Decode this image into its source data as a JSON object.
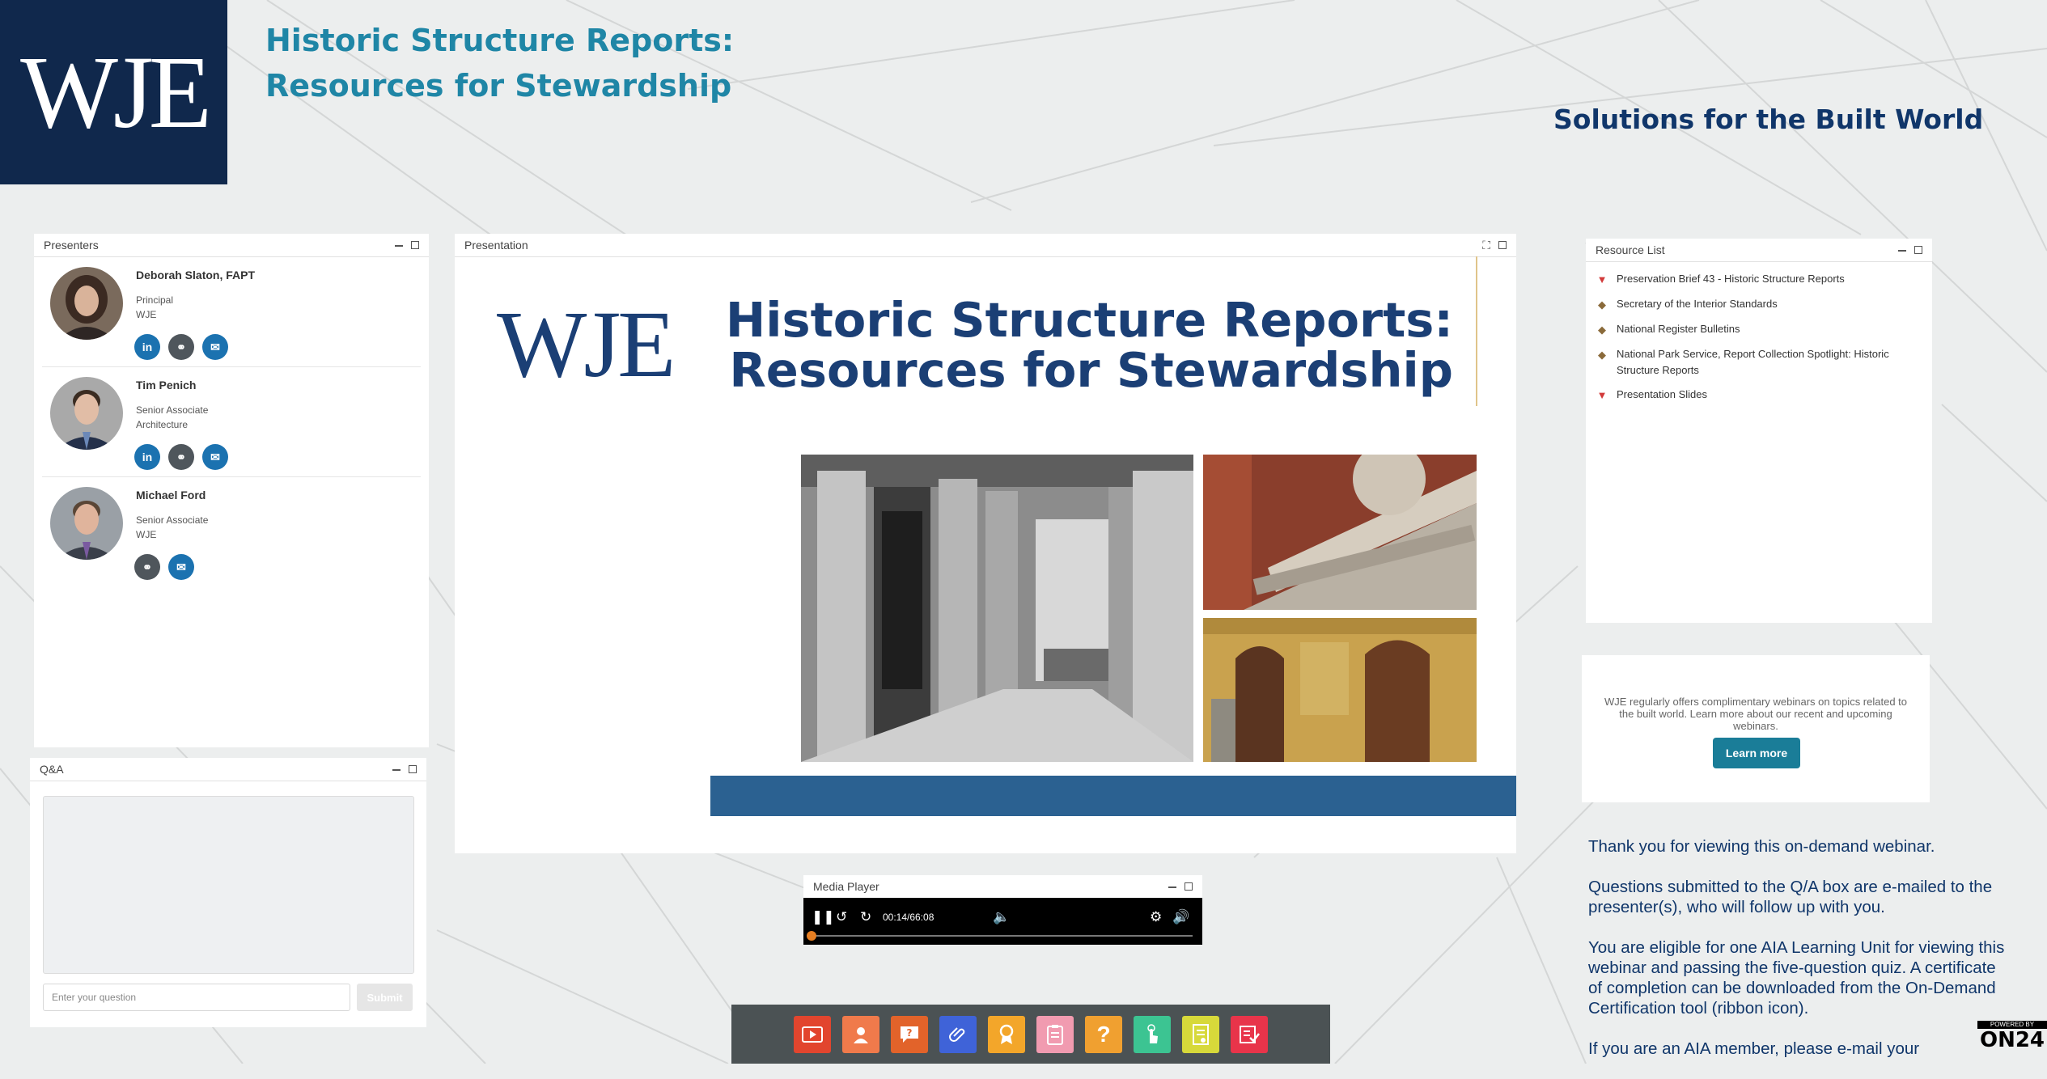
{
  "header": {
    "logo_text": "WJE",
    "title_line1": "Historic Structure Reports:",
    "title_line2": "Resources for Stewardship",
    "tagline": "Solutions for the Built World"
  },
  "presenters_panel": {
    "title": "Presenters",
    "presenters": [
      {
        "name": "Deborah Slaton, FAPT",
        "role": "Principal",
        "org": "WJE",
        "social": [
          "linkedin-icon",
          "link-icon",
          "mail-icon"
        ]
      },
      {
        "name": "Tim Penich",
        "role": "Senior Associate",
        "org": "Architecture",
        "social": [
          "linkedin-icon",
          "link-icon",
          "mail-icon"
        ]
      },
      {
        "name": "Michael Ford",
        "role": "Senior Associate",
        "org": "WJE",
        "social": [
          "link-icon",
          "mail-icon"
        ]
      }
    ]
  },
  "qa_panel": {
    "title": "Q&A",
    "input_placeholder": "Enter your question",
    "submit_label": "Submit"
  },
  "presentation_panel": {
    "title": "Presentation",
    "slide": {
      "logo": "WJE",
      "title_line1": "Historic Structure Reports:",
      "title_line2": "Resources for Stewardship"
    }
  },
  "resource_panel": {
    "title": "Resource List",
    "items": [
      {
        "label": "Preservation Brief 43 - Historic Structure Reports",
        "icon": "pdf-icon"
      },
      {
        "label": "Secretary of the Interior Standards",
        "icon": "nps-shield-icon"
      },
      {
        "label": "National Register Bulletins",
        "icon": "nps-shield-icon"
      },
      {
        "label": "National Park Service, Report Collection Spotlight: Historic Structure Reports",
        "icon": "nps-shield-icon"
      },
      {
        "label": "Presentation Slides",
        "icon": "pdf-icon"
      }
    ]
  },
  "promo_panel": {
    "text": "WJE regularly offers complimentary webinars on topics related to the built world. Learn more about our recent and upcoming webinars.",
    "button_label": "Learn more"
  },
  "thanks": {
    "p1": "Thank you for viewing this on-demand webinar.",
    "p2": "Questions submitted to the Q/A box are e-mailed to the presenter(s), who will follow up with you.",
    "p3": "You are eligible for one AIA Learning Unit for viewing this webinar and passing the five-question quiz. A certificate of completion can be downloaded from the On-Demand Certification tool (ribbon icon).",
    "p4": "If you are an AIA member, please e-mail your"
  },
  "media_player": {
    "title": "Media Player",
    "time": "00:14/66:08",
    "progress_fraction": 0.0035
  },
  "toolbar": {
    "tools": [
      {
        "name": "media-player-tool",
        "icon": "play-icon",
        "color": "#e2452e"
      },
      {
        "name": "presenters-tool",
        "icon": "person-icon",
        "color": "#f07a4b"
      },
      {
        "name": "qa-tool",
        "icon": "question-bubble-icon",
        "color": "#e2632a"
      },
      {
        "name": "resources-tool",
        "icon": "paperclip-icon",
        "color": "#3f63d8"
      },
      {
        "name": "certificate-tool",
        "icon": "ribbon-icon",
        "color": "#f3a62a"
      },
      {
        "name": "notes-tool",
        "icon": "clipboard-icon",
        "color": "#f19bb0"
      },
      {
        "name": "help-tool",
        "icon": "question-icon",
        "color": "#f0a030"
      },
      {
        "name": "interact-tool",
        "icon": "pointer-icon",
        "color": "#3cc492"
      },
      {
        "name": "survey-tool",
        "icon": "document-icon",
        "color": "#d7d93a"
      },
      {
        "name": "quiz-tool",
        "icon": "checklist-icon",
        "color": "#e8344a"
      }
    ]
  },
  "branding": {
    "powered_by": "POWERED BY",
    "on24": "ON24"
  }
}
